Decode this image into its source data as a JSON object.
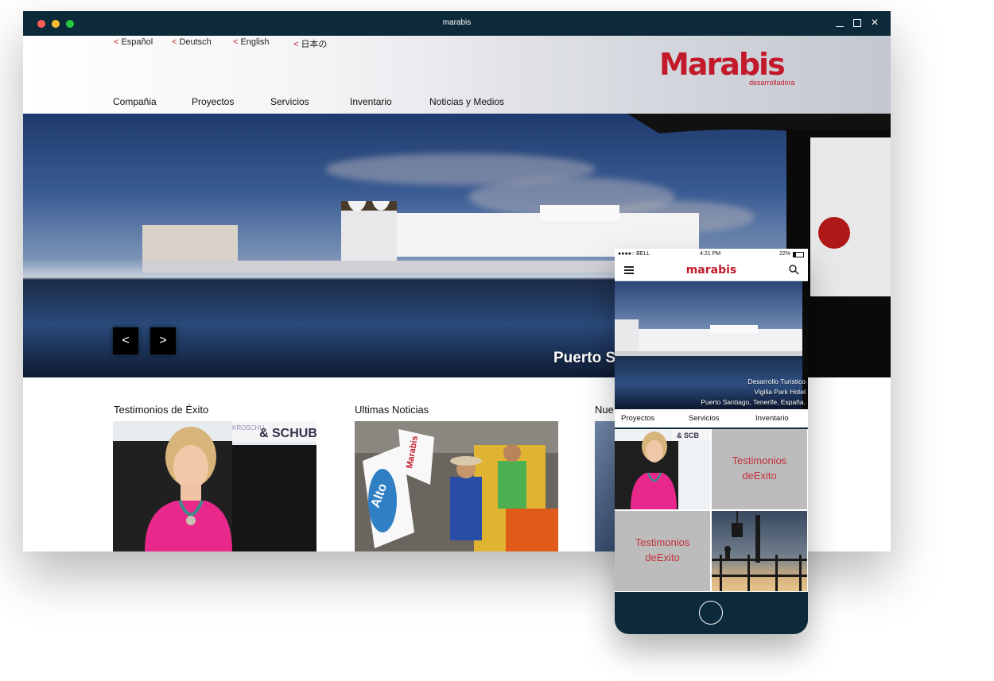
{
  "window": {
    "title": "marabis"
  },
  "site": {
    "languages": [
      "Español",
      "Deutsch",
      "English",
      "日本の"
    ],
    "lang_chevron": "<",
    "logo": {
      "word": "Marabis",
      "sub": "desarrolladora",
      "color": "#c21a2a"
    },
    "nav": [
      "Compañia",
      "Proyectos",
      "Servicios",
      "Inventario",
      "Noticias y Medios"
    ]
  },
  "hero": {
    "prev": "<",
    "next": ">",
    "caption": "Puerto So"
  },
  "sections": [
    {
      "title": "Testimonios de Éxito",
      "image": "woman-at-desk"
    },
    {
      "title": "Ultimas Noticias",
      "image": "workers-with-flags"
    },
    {
      "title": "Nue",
      "image": "sky-photo"
    }
  ],
  "thumb_text": {
    "sign": "& SCHUB",
    "sign_prefix": "KROSCHU",
    "flag1": "Marabis",
    "flag2": "Alto"
  },
  "phone": {
    "status": {
      "carrier": "●●●●○ BELL",
      "time": "4:21 PM",
      "battery": "22%"
    },
    "logo": "marabis",
    "caption": [
      "Desarrollo Turistico",
      "Vigilia Park Hotel",
      "Puerto Santiago, Tenerife, España."
    ],
    "tabs": [
      "Proyectos",
      "Servicios",
      "Inventario"
    ],
    "tiles": [
      {
        "kind": "photo",
        "label": ""
      },
      {
        "kind": "text",
        "line1": "Testimonios",
        "line2": "deExito"
      },
      {
        "kind": "text",
        "line1": "Testimonios",
        "line2": "deExito"
      },
      {
        "kind": "photo",
        "label": ""
      }
    ],
    "tile_sign": "& SCB"
  },
  "colors": {
    "brand": "#c21a2a",
    "titlebar": "#0d2a3a"
  },
  "icons": [
    "close-icon",
    "minimize-icon",
    "maximize-icon",
    "menu-icon",
    "search-icon",
    "home-button-icon"
  ]
}
